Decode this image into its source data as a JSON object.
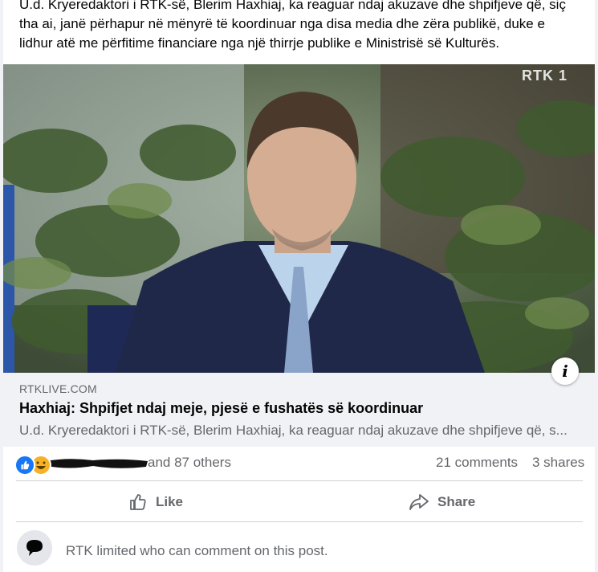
{
  "post": {
    "text_line1": "U.d. Kryeredaktori i RTK-së, Blerim Haxhiaj, ka reaguar ndaj akuzave dhe shpifjeve që, siç",
    "text_line2": "tha ai, janë përhapur në mënyrë të koordinuar nga disa media dhe zëra publikë, duke e",
    "text_line3": "lidhur atë me përfitime financiare nga një thirrje publike e Ministrisë së Kulturës."
  },
  "media": {
    "watermark": "RTK 1",
    "info_glyph": "i"
  },
  "link_preview": {
    "domain": "RTKLIVE.COM",
    "title": "Haxhiaj: Shpifjet ndaj meje, pjesë e fushatës së koordinuar",
    "description": "U.d. Kryeredaktori i RTK-së, Blerim Haxhiaj, ka reaguar ndaj akuzave dhe shpifjeve që, s..."
  },
  "engagement": {
    "reaction_icons": [
      "like-icon",
      "haha-icon"
    ],
    "reactions_text": "and 87 others",
    "comments_text": "21 comments",
    "shares_text": "3 shares"
  },
  "actions": {
    "like_label": "Like",
    "share_label": "Share"
  },
  "comment_status": {
    "text": "RTK limited who can comment on this post."
  },
  "colors": {
    "brand_blue": "#1877f2",
    "secondary_text": "#65676b",
    "preview_bg": "#f0f2f5"
  }
}
